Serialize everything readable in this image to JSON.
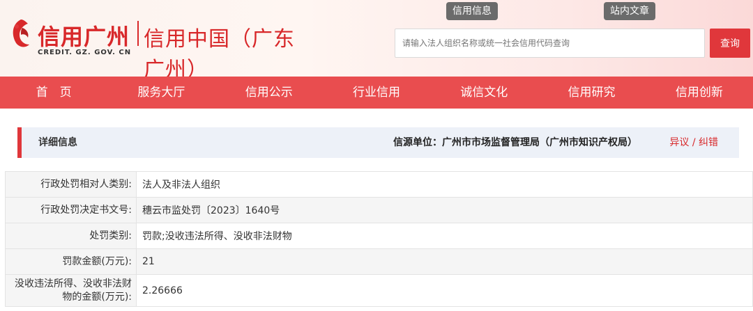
{
  "header": {
    "logo_main": "信用广州",
    "logo_sub": "信用中国（广东广州）",
    "logo_url": "CREDIT. GZ. GOV. CN",
    "tab_credit_info": "信用信息",
    "tab_site_articles": "站内文章",
    "search": {
      "placeholder": "请输入法人组织名称或统一社会信用代码查询",
      "button_label": "查询"
    }
  },
  "nav": {
    "items": [
      "首　页",
      "服务大厅",
      "信用公示",
      "行业信用",
      "诚信文化",
      "信用研究",
      "信用创新"
    ]
  },
  "info_bar": {
    "title": "详细信息",
    "source": "信源单位：广州市市场监督管理局（广州市知识产权局）",
    "dispute": "异议 / 纠错"
  },
  "details": [
    {
      "label": "行政处罚相对人类别:",
      "value": "法人及非法人组织"
    },
    {
      "label": "行政处罚决定书文号:",
      "value": "穗云市监处罚〔2023〕1640号"
    },
    {
      "label": "处罚类别:",
      "value": "罚款;没收违法所得、没收非法财物"
    },
    {
      "label": "罚款金额(万元):",
      "value": "21"
    },
    {
      "label": "没收违法所得、没收非法财物的金额(万元):",
      "value": "2.26666"
    }
  ],
  "colors": {
    "brand_red": "#d8282a",
    "nav_red": "#e94d4f",
    "tab_gray": "#6b6b6b",
    "info_bar_bg": "#edf1f8"
  }
}
